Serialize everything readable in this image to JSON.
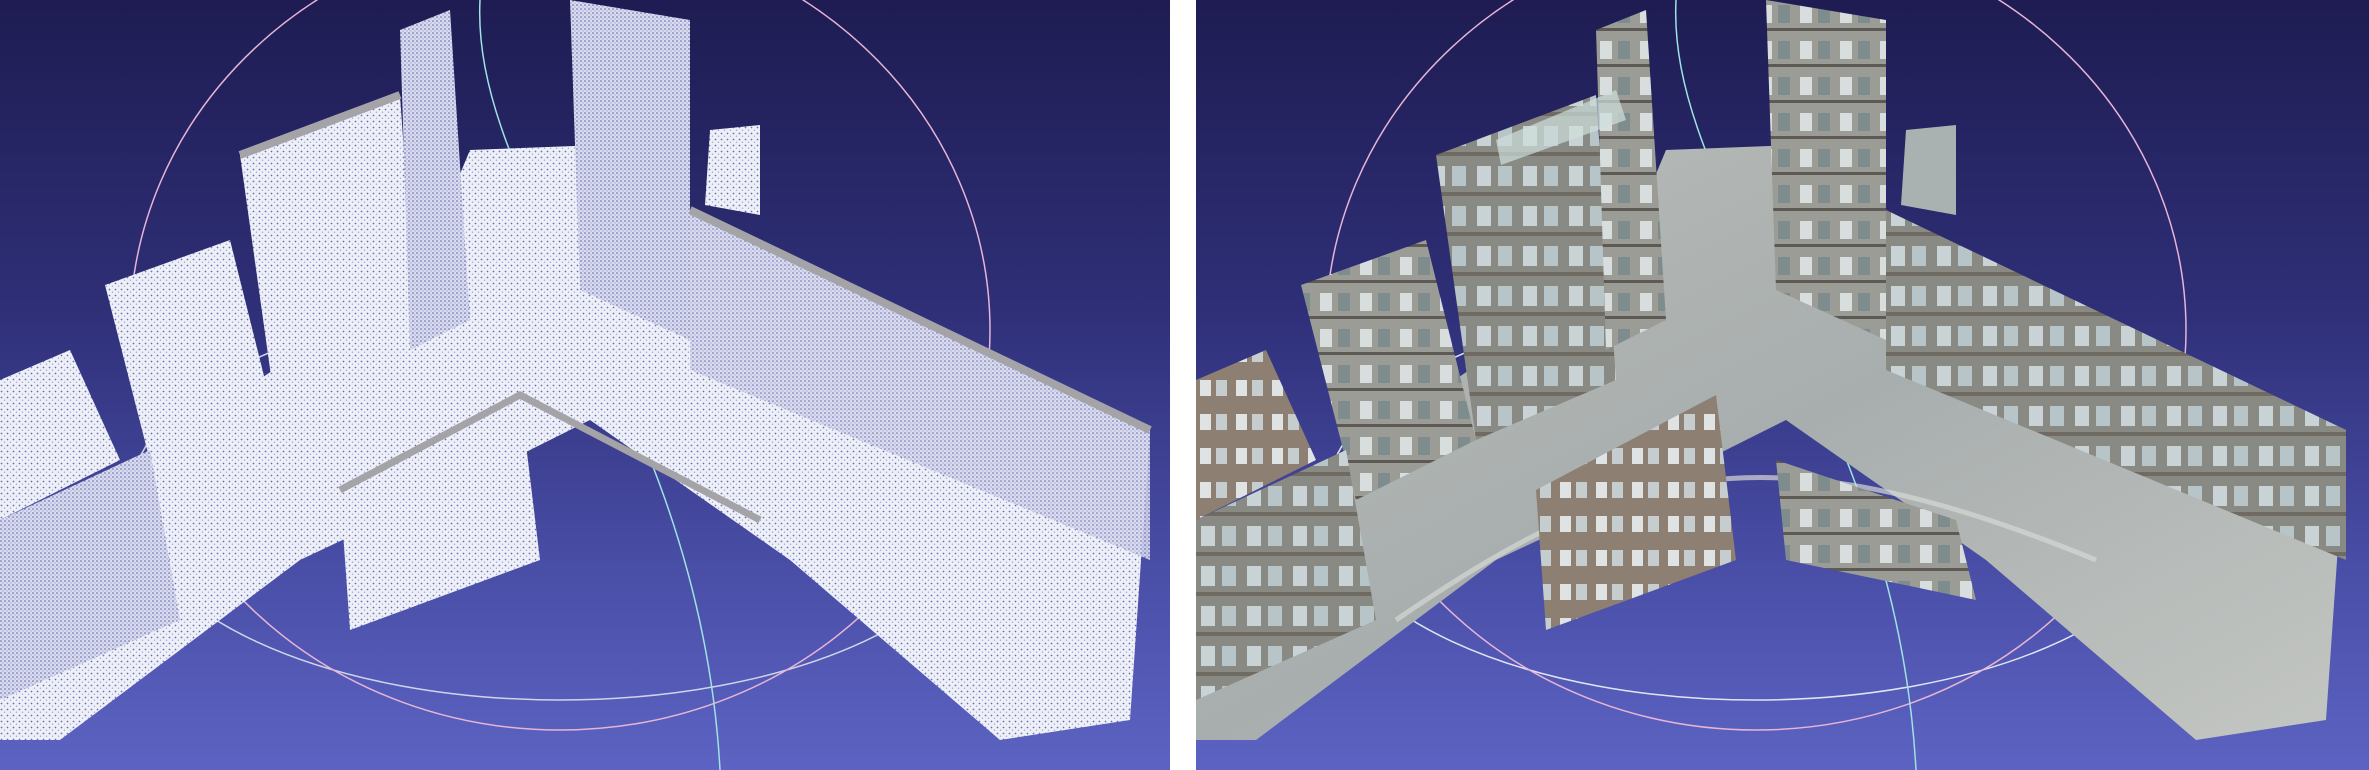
{
  "scene": {
    "panels": [
      {
        "id": "point-cloud",
        "content": "untextured-dense-point-cloud"
      },
      {
        "id": "textured-mesh",
        "content": "textured-reconstruction"
      }
    ],
    "colors": {
      "background_top": "#1e1c52",
      "background_bottom": "#5c63c2",
      "trackball_pink": "#e7b4d6",
      "trackball_white": "#dfe6f2",
      "trackball_cyan": "#9fe3e3"
    }
  }
}
